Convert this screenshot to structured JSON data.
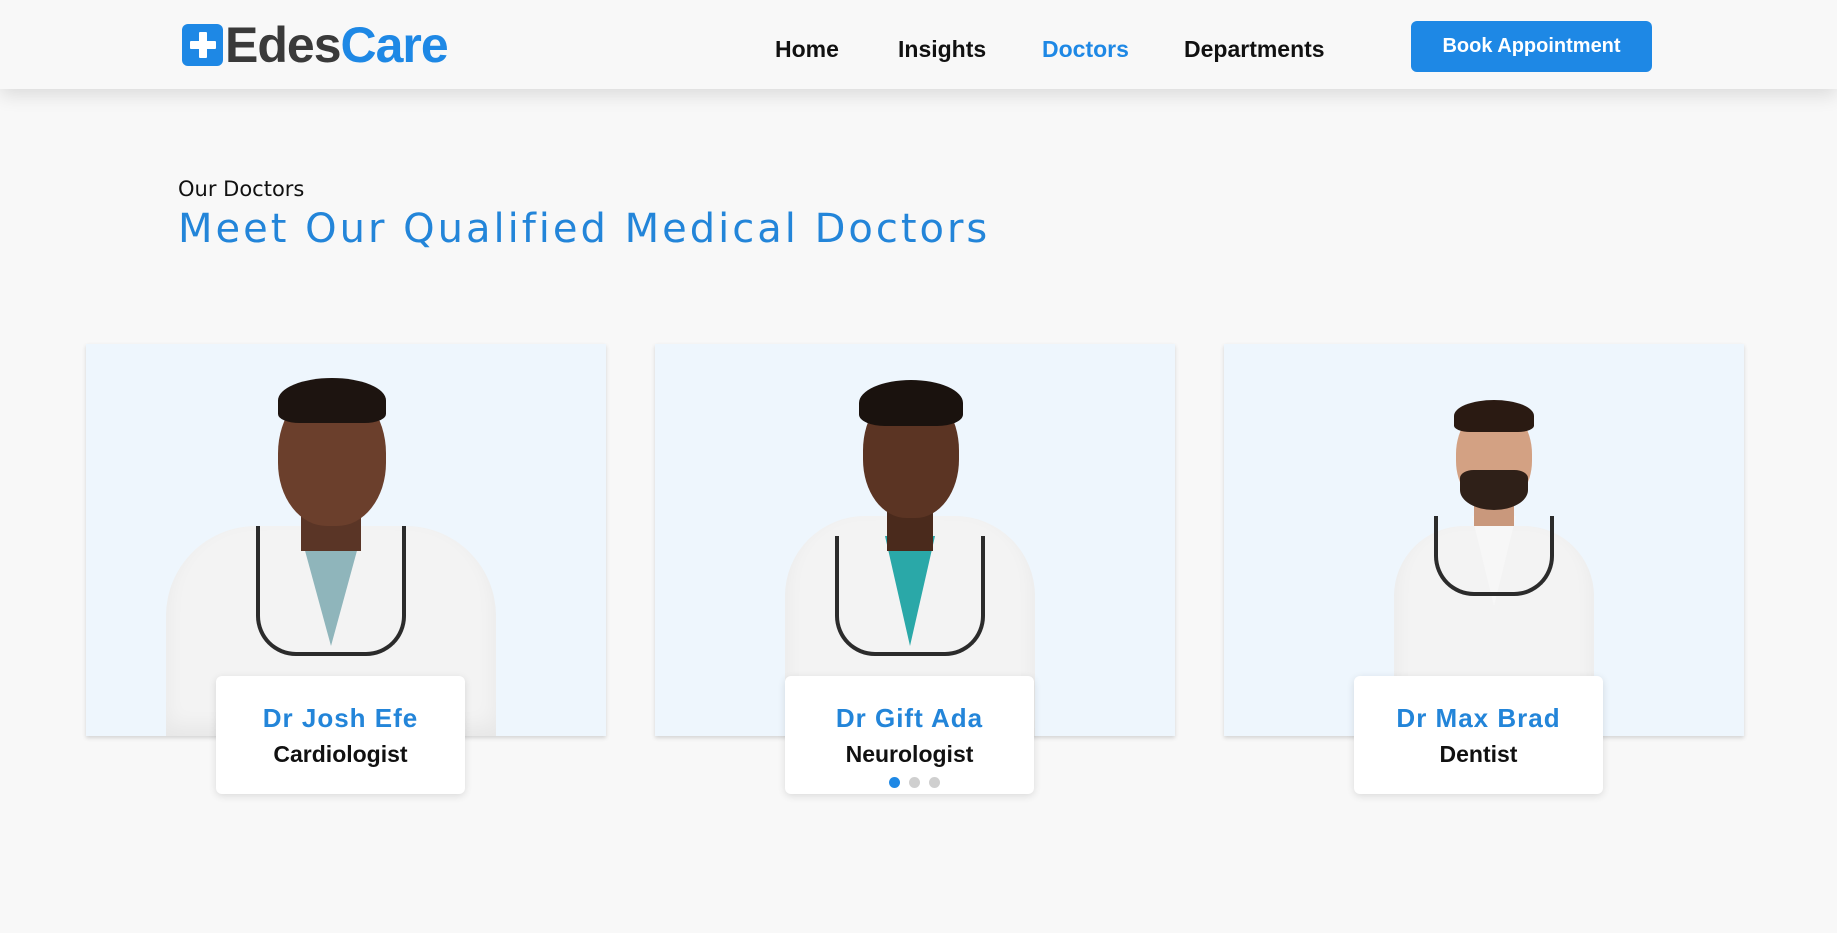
{
  "brand": {
    "part1": "Edes",
    "part2": "Care",
    "accent": "#1e88e5",
    "icon": "medical-cross-icon"
  },
  "nav": {
    "items": [
      {
        "label": "Home",
        "active": false
      },
      {
        "label": "Insights",
        "active": false
      },
      {
        "label": "Doctors",
        "active": true
      },
      {
        "label": "Departments",
        "active": false
      }
    ],
    "cta": "Book Appointment"
  },
  "section": {
    "eyebrow": "Our Doctors",
    "title": "Meet Our Qualified Medical Doctors"
  },
  "doctors": [
    {
      "name": "Dr Josh Efe",
      "role": "Cardiologist"
    },
    {
      "name": "Dr Gift Ada",
      "role": "Neurologist"
    },
    {
      "name": "Dr Max Brad",
      "role": "Dentist"
    }
  ],
  "carousel": {
    "page_count": 3,
    "active_index": 0
  }
}
